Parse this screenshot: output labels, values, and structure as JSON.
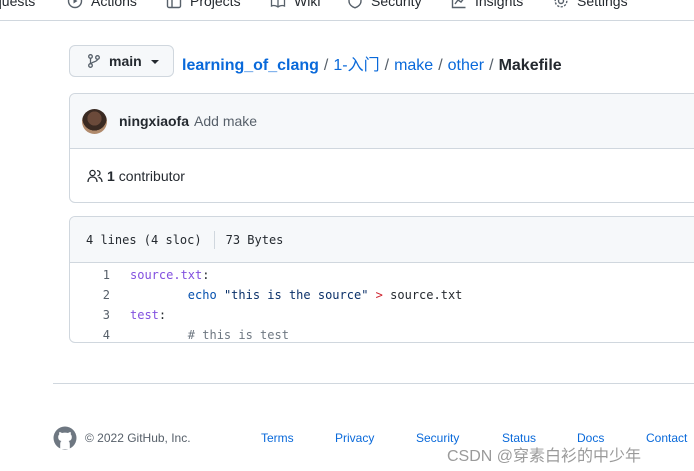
{
  "repo_nav": {
    "items": [
      {
        "label": "quests",
        "icon": "pull-request-icon"
      },
      {
        "label": "Actions",
        "icon": "play-icon"
      },
      {
        "label": "Projects",
        "icon": "table-icon"
      },
      {
        "label": "Wiki",
        "icon": "book-icon"
      },
      {
        "label": "Security",
        "icon": "shield-icon"
      },
      {
        "label": "Insights",
        "icon": "graph-icon"
      },
      {
        "label": "Settings",
        "icon": "gear-icon"
      }
    ]
  },
  "branch": {
    "label": "main",
    "icon": "git-branch-icon"
  },
  "breadcrumb": {
    "repo": "learning_of_clang",
    "segments": [
      "1-入门",
      "make",
      "other"
    ],
    "separator": "/",
    "file": "Makefile"
  },
  "commit": {
    "author": "ningxiaofa",
    "message": "Add make",
    "contributors_count": "1",
    "contributors_label": "contributor"
  },
  "file_info": {
    "lines": "4 lines (4 sloc)",
    "size": "73 Bytes"
  },
  "code_lines": [
    {
      "n": "1"
    },
    {
      "n": "2"
    },
    {
      "n": "3"
    },
    {
      "n": "4"
    }
  ],
  "code": {
    "l1_target": "source.txt",
    "l1_colon": ":",
    "l2_indent": "        ",
    "l2_cmd": "echo",
    "l2_str": "\"this is the source\"",
    "l2_op": ">",
    "l2_file": "source.txt",
    "l3_target": "test",
    "l3_colon": ":",
    "l4_indent": "        ",
    "l4_comment": "# this is test"
  },
  "footer": {
    "copyright": "© 2022 GitHub, Inc.",
    "links": [
      "Terms",
      "Privacy",
      "Security",
      "Status",
      "Docs",
      "Contact"
    ]
  },
  "watermark": "CSDN @穿素白衫的中少年",
  "colors": {
    "link": "#0969da",
    "border": "#d0d7de",
    "header_bg": "#f6f8fa",
    "keyword_purple": "#8250df",
    "string_blue": "#0a3069",
    "operator_red": "#cf222e"
  }
}
